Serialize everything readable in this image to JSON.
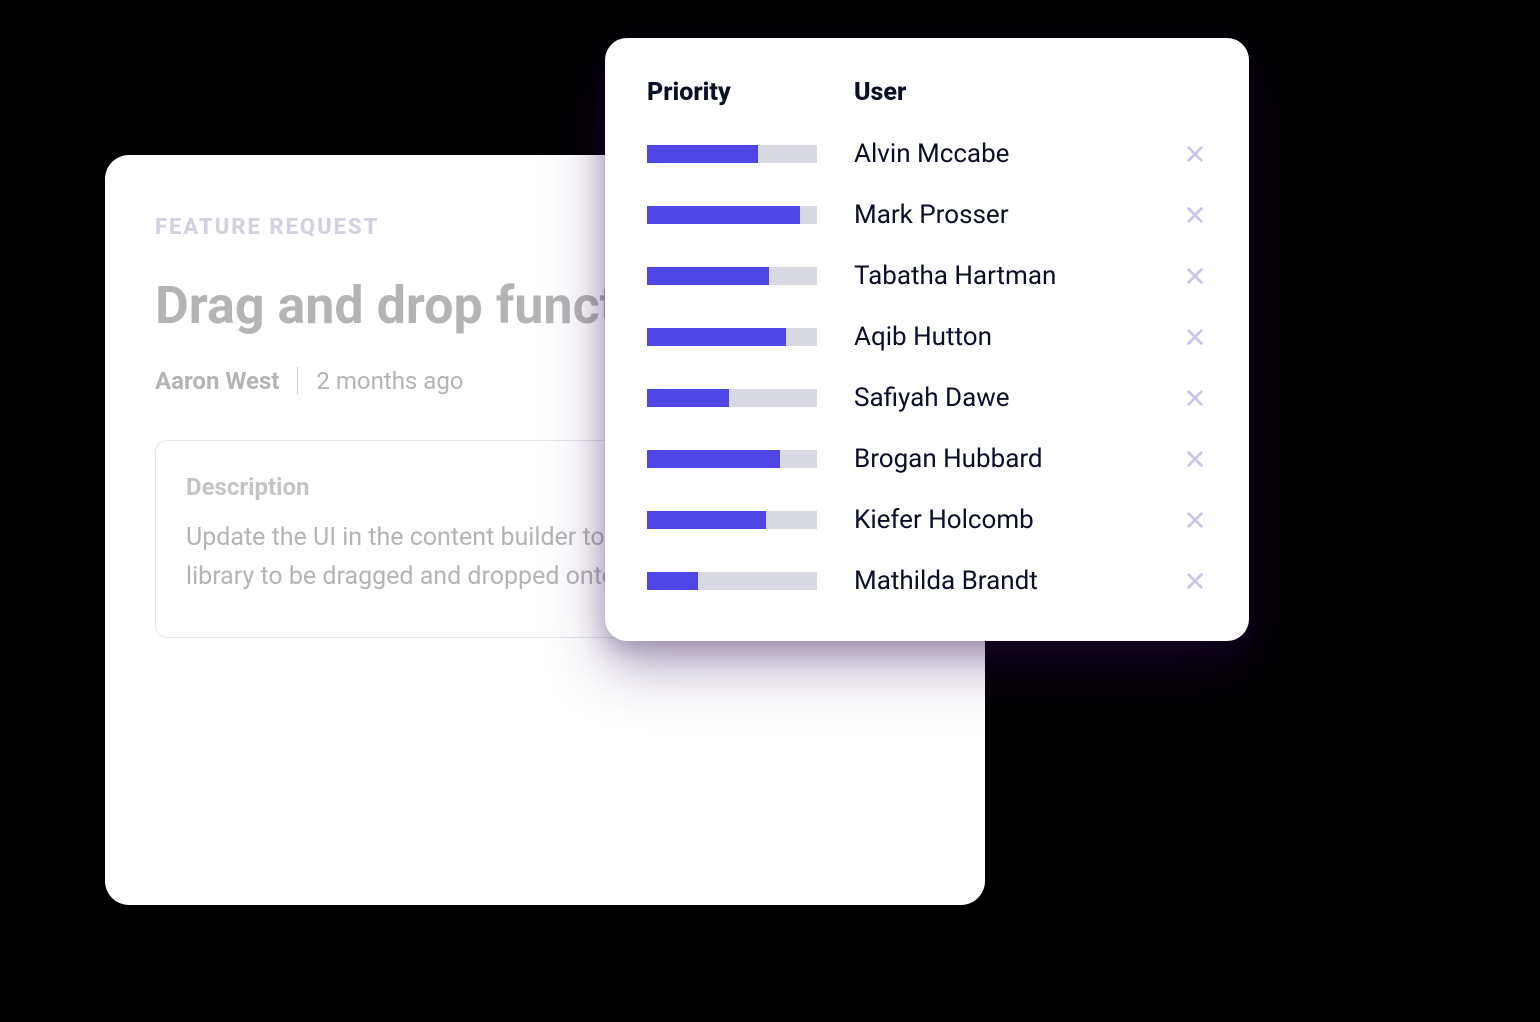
{
  "feature_card": {
    "tag": "FEATURE REQUEST",
    "title": "Drag and drop functionality",
    "author": "Aaron West",
    "time": "2 months ago",
    "description_label": "Description",
    "description_text": "Update the UI in the content builder to allow items from the library to be dragged and dropped onto containers"
  },
  "priority_panel": {
    "headers": {
      "priority": "Priority",
      "user": "User"
    },
    "rows": [
      {
        "priority_pct": 65,
        "user": "Alvin Mccabe"
      },
      {
        "priority_pct": 90,
        "user": "Mark Prosser"
      },
      {
        "priority_pct": 72,
        "user": "Tabatha Hartman"
      },
      {
        "priority_pct": 82,
        "user": "Aqib Hutton"
      },
      {
        "priority_pct": 48,
        "user": "Safiyah Dawe"
      },
      {
        "priority_pct": 78,
        "user": "Brogan Hubbard"
      },
      {
        "priority_pct": 70,
        "user": "Kiefer Holcomb"
      },
      {
        "priority_pct": 30,
        "user": "Mathilda Brandt"
      }
    ]
  },
  "colors": {
    "accent": "#4f46e5",
    "bar_bg": "#d9d9e2",
    "close_icon": "#c7c5e8",
    "text_dark": "#0a0e27",
    "text_muted": "#b4b4b4"
  }
}
